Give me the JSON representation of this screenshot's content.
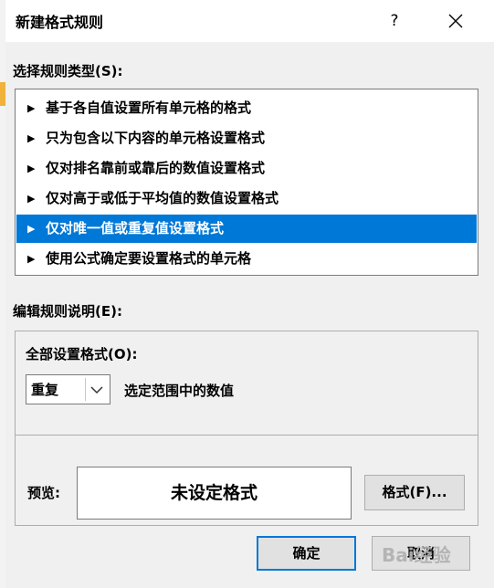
{
  "window": {
    "title": "新建格式规则",
    "help": "?"
  },
  "rule_type": {
    "label": "选择规则类型(S):",
    "items": [
      {
        "label": "基于各自值设置所有单元格的格式",
        "selected": false
      },
      {
        "label": "只为包含以下内容的单元格设置格式",
        "selected": false
      },
      {
        "label": "仅对排名靠前或靠后的数值设置格式",
        "selected": false
      },
      {
        "label": "仅对高于或低于平均值的数值设置格式",
        "selected": false
      },
      {
        "label": "仅对唯一值或重复值设置格式",
        "selected": true
      },
      {
        "label": "使用公式确定要设置格式的单元格",
        "selected": false
      }
    ]
  },
  "description": {
    "label": "编辑规则说明(E):",
    "format_all_label": "全部设置格式(O):",
    "combo_value": "重复",
    "combo_suffix": "选定范围中的数值",
    "preview_label": "预览:",
    "preview_text": "未设定格式",
    "format_button": "格式(F)..."
  },
  "buttons": {
    "ok": "确定",
    "cancel": "取消"
  },
  "watermark": "Bai经验",
  "colors": {
    "selection": "#0078d7",
    "dialog_bg": "#f0f0f0"
  }
}
